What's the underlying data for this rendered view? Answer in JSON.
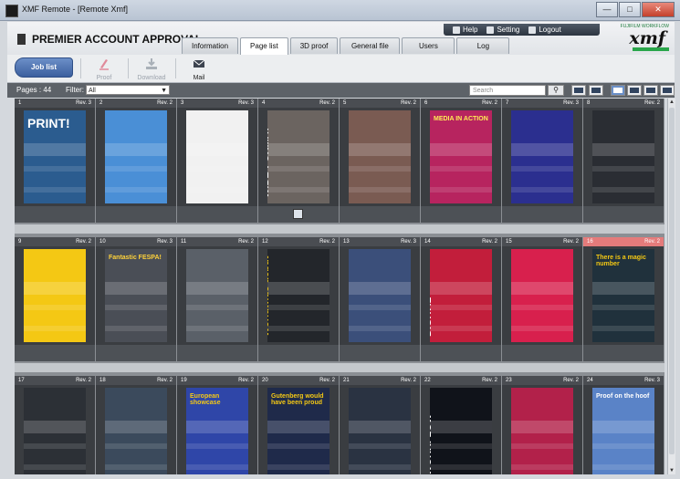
{
  "window": {
    "title": "XMF Remote - [Remote Xmf]",
    "controls": [
      "—",
      "□",
      "✕"
    ]
  },
  "header": {
    "brand": "PREMIER ACCOUNT APPROVAL",
    "top_links": [
      "Help",
      "Setting",
      "Logout"
    ],
    "logo_text": "xmf",
    "logo_tag": "FUJIFILM WORKFLOW"
  },
  "tabs": [
    {
      "label": "Information",
      "active": false
    },
    {
      "label": "Page list",
      "active": true
    },
    {
      "label": "3D proof",
      "active": false
    },
    {
      "label": "General file",
      "active": false
    },
    {
      "label": "Users",
      "active": false
    },
    {
      "label": "Log",
      "active": false
    }
  ],
  "toolbar": {
    "job_list": "Job list",
    "proof": "Proof",
    "download": "Download",
    "mail": "Mail"
  },
  "filter": {
    "pages_label": "Pages : 44",
    "filter_label": "Filter:",
    "filter_value": "All",
    "search_placeholder": "Search"
  },
  "pages": [
    {
      "num": "1",
      "rev": "Rev. 3",
      "bg": "#2b5c8f",
      "txt": "PRINT!",
      "txtcolor": "#ffffff"
    },
    {
      "num": "2",
      "rev": "Rev. 2",
      "bg": "#4a8fd6",
      "txt": "",
      "txtcolor": "#ffffff"
    },
    {
      "num": "3",
      "rev": "Rev. 3",
      "bg": "#f1f1f1",
      "txt": "",
      "txtcolor": "#333333"
    },
    {
      "num": "4",
      "rev": "Rev. 2",
      "bg": "#6b6460",
      "txt": "WIDE-FORMAT",
      "txtcolor": "#ffffff",
      "vertical": true
    },
    {
      "num": "5",
      "rev": "Rev. 2",
      "bg": "#7a5b52",
      "txt": "",
      "txtcolor": "#ffffff"
    },
    {
      "num": "6",
      "rev": "Rev. 2",
      "bg": "#b7245f",
      "txt": "MEDIA IN ACTION",
      "txtcolor": "#ffee55"
    },
    {
      "num": "7",
      "rev": "Rev. 3",
      "bg": "#2b2f8f",
      "txt": "",
      "txtcolor": "#ffffff"
    },
    {
      "num": "8",
      "rev": "Rev. 2",
      "bg": "#2a2d33",
      "txt": "",
      "txtcolor": "#ffffff"
    },
    {
      "num": "9",
      "rev": "Rev. 2",
      "bg": "#f4c814",
      "txt": "",
      "txtcolor": "#111111"
    },
    {
      "num": "10",
      "rev": "Rev. 3",
      "bg": "#4a4e56",
      "txt": "Fantastic FESPA!",
      "txtcolor": "#ffd23a"
    },
    {
      "num": "11",
      "rev": "Rev. 2",
      "bg": "#5a6068",
      "txt": "",
      "txtcolor": "#ffffff"
    },
    {
      "num": "12",
      "rev": "Rev. 2",
      "bg": "#23262b",
      "txt": "Worldwide debut",
      "txtcolor": "#f4c814",
      "vertical": true
    },
    {
      "num": "13",
      "rev": "Rev. 3",
      "bg": "#3b4f7a",
      "txt": "",
      "txtcolor": "#ffffff"
    },
    {
      "num": "14",
      "rev": "Rev. 2",
      "bg": "#c21e3b",
      "txt": "DIGITAL",
      "txtcolor": "#ffffff",
      "vertical": true
    },
    {
      "num": "15",
      "rev": "Rev. 2",
      "bg": "#d8204d",
      "txt": "",
      "txtcolor": "#ffffff"
    },
    {
      "num": "16",
      "rev": "Rev. 2",
      "bg": "#20313c",
      "txt": "There is a magic number",
      "txtcolor": "#f4c814",
      "flag": true
    },
    {
      "num": "17",
      "rev": "Rev. 2",
      "bg": "#2c3036",
      "txt": "",
      "txtcolor": "#ffffff"
    },
    {
      "num": "18",
      "rev": "Rev. 2",
      "bg": "#3b4a5c",
      "txt": "",
      "txtcolor": "#ffffff"
    },
    {
      "num": "19",
      "rev": "Rev. 2",
      "bg": "#2f46a8",
      "txt": "European showcase",
      "txtcolor": "#f4c814"
    },
    {
      "num": "20",
      "rev": "Rev. 2",
      "bg": "#1f2a4a",
      "txt": "Gutenberg would have been proud",
      "txtcolor": "#f4c814"
    },
    {
      "num": "21",
      "rev": "Rev. 2",
      "bg": "#2a3342",
      "txt": "",
      "txtcolor": "#ffffff"
    },
    {
      "num": "22",
      "rev": "Rev. 2",
      "bg": "#10131a",
      "txt": "WORKFLOW",
      "txtcolor": "#ffffff",
      "vertical": true
    },
    {
      "num": "23",
      "rev": "Rev. 2",
      "bg": "#b2214a",
      "txt": "",
      "txtcolor": "#ffffff"
    },
    {
      "num": "24",
      "rev": "Rev. 3",
      "bg": "#5a83c7",
      "txt": "Proof on the hoof",
      "txtcolor": "#ffffff"
    }
  ]
}
